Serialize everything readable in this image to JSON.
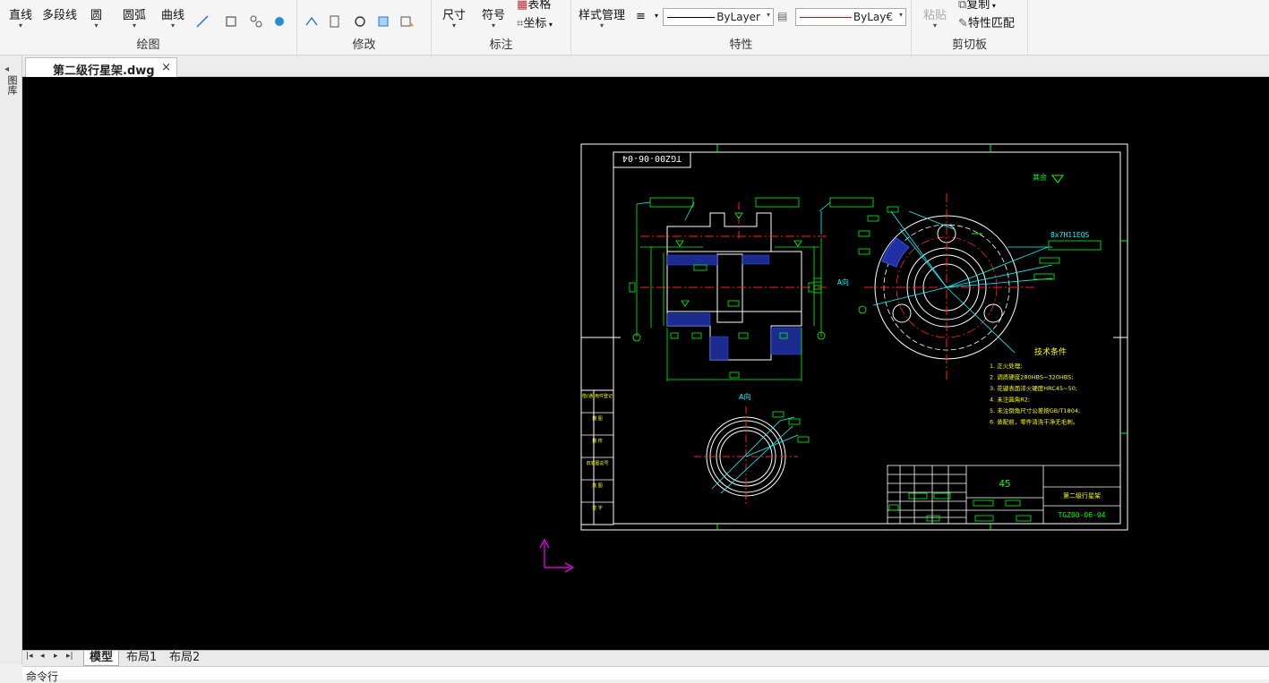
{
  "ribbon": {
    "draw": {
      "title": "绘图",
      "line": "直线",
      "polyline": "多段线",
      "circle": "圆",
      "arc": "圆弧",
      "curve": "曲线"
    },
    "modify": {
      "title": "修改"
    },
    "annotate": {
      "title": "标注",
      "dimension": "尺寸",
      "symbol": "符号",
      "table": "表格",
      "coordinate": "坐标"
    },
    "properties": {
      "title": "特性",
      "style_manager": "样式管理",
      "linetype_value": "ByLayer",
      "color_value": "ByLay€"
    },
    "clipboard": {
      "title": "剪切板",
      "paste": "粘贴",
      "copy": "复制",
      "match_properties": "特性匹配"
    }
  },
  "sidebar": {
    "label": "图库"
  },
  "document_tab": {
    "title": "第二级行星架.dwg",
    "close": "×"
  },
  "layout_tabs": [
    "模型",
    "布局1",
    "布局2"
  ],
  "command_line": {
    "prompt": "命令行"
  },
  "drawing": {
    "part_code_mirrored": "TGZ00-06-04",
    "roughness_note": "其余",
    "view_label": "A向",
    "side_label": "A向",
    "spline_spec": "8x7H11EQS",
    "tech_title": "技术条件",
    "tech_items": [
      "1. 正火处理;",
      "2. 调质硬度280HBS~320HBS;",
      "3. 花键表面淬火硬度HRC45~50;",
      "4. 未注圆角R2;",
      "5. 未注倒角尺寸公差按GB/T1804;",
      "6. 装配前，零件清洗干净无毛刺。"
    ],
    "title_block": {
      "scale": "45",
      "part_name": "第二级行星架",
      "part_code": "TGZ00-06-04"
    },
    "left_labels": [
      "借(通)用件登记",
      "描 图",
      "描 校",
      "旧底图总号",
      "底 图",
      "签 字"
    ]
  },
  "colors": {
    "canvas_bg": "#000000",
    "frame": "#ffffff",
    "dim_green": "#00ff00",
    "center_red": "#ff2020",
    "leader_cyan": "#00ffff",
    "hatch_blue": "#3050ff",
    "ucs_magenta": "#ff00ff",
    "text_yellow": "#ffff00"
  }
}
